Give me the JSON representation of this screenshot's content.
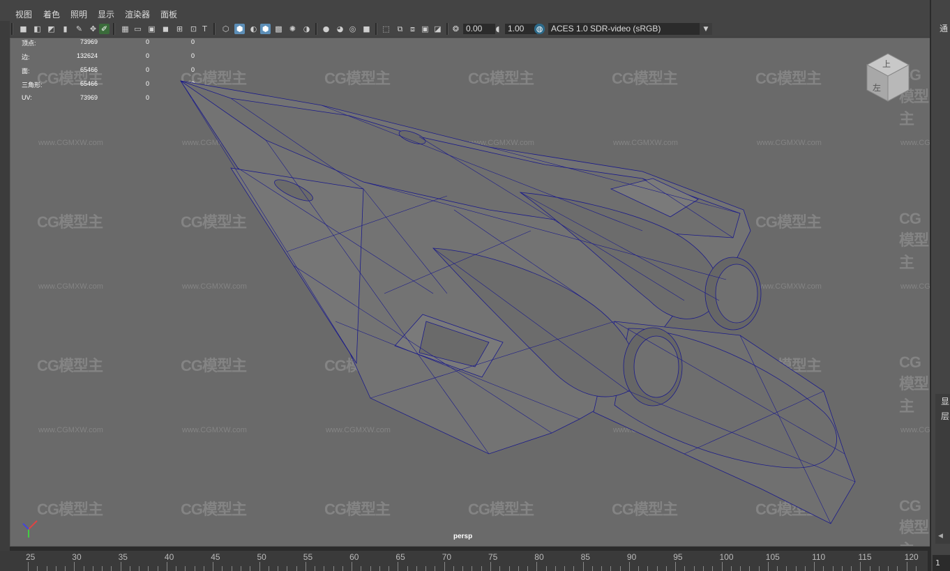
{
  "menubar": {
    "items": [
      "视图",
      "着色",
      "照明",
      "显示",
      "渲染器",
      "面板"
    ]
  },
  "toolbar": {
    "exposure_value": "0.00",
    "gamma_value": "1.00",
    "color_management": "ACES 1.0 SDR-video (sRGB)"
  },
  "hud": {
    "rows": [
      {
        "label": "顶点:",
        "a": "73969",
        "b": "0",
        "c": "0"
      },
      {
        "label": "边:",
        "a": "132624",
        "b": "0",
        "c": "0"
      },
      {
        "label": "面:",
        "a": "65466",
        "b": "0",
        "c": "0"
      },
      {
        "label": "三角形:",
        "a": "65466",
        "b": "0",
        "c": "0"
      },
      {
        "label": "UV:",
        "a": "73969",
        "b": "0",
        "c": "0"
      }
    ]
  },
  "viewport": {
    "camera_label": "persp",
    "watermark_logo": "CG模型主",
    "watermark_url": "www.CGMXW.com",
    "wire_color": "#1a1a8a",
    "bg_color": "#6a6a6a",
    "view_cube_faces": [
      "上",
      "左"
    ]
  },
  "right_panel": {
    "top_label": "通",
    "side_labels": [
      "显",
      "层"
    ]
  },
  "timeline": {
    "ticks": [
      "25",
      "30",
      "35",
      "40",
      "45",
      "50",
      "55",
      "60",
      "65",
      "70",
      "75",
      "80",
      "85",
      "90",
      "95",
      "100",
      "105",
      "110",
      "115",
      "120"
    ],
    "current_frame": "1"
  }
}
